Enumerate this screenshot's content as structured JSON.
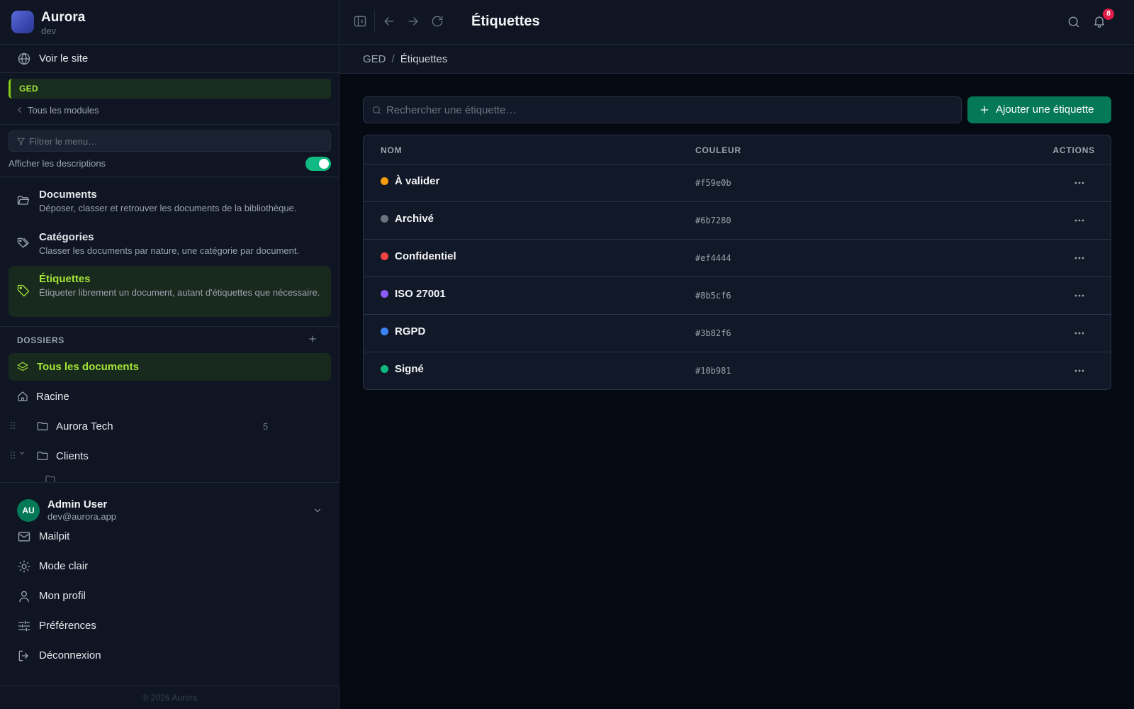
{
  "brand": {
    "name": "Aurora",
    "env": "dev"
  },
  "sidebar": {
    "view_site": "Voir le site",
    "module_badge": "GED",
    "all_modules": "Tous les modules",
    "filter_placeholder": "Filtrer le menu…",
    "show_descriptions": "Afficher les descriptions",
    "show_descriptions_on": true,
    "nav": [
      {
        "title": "Documents",
        "desc": "Déposer, classer et retrouver les documents de la bibliothèque.",
        "icon": "folder-open-icon",
        "active": false
      },
      {
        "title": "Catégories",
        "desc": "Classer les documents par nature, une catégorie par document.",
        "icon": "tags-icon",
        "active": false
      },
      {
        "title": "Étiquettes",
        "desc": "Étiqueter librement un document, autant d'étiquettes que nécessaire.",
        "icon": "tag-icon",
        "active": true
      }
    ],
    "dossiers_label": "DOSSIERS",
    "folders": {
      "all": "Tous les documents",
      "root": "Racine",
      "items": [
        {
          "name": "Aurora Tech",
          "count": "5"
        },
        {
          "name": "Clients",
          "count": ""
        }
      ]
    }
  },
  "user": {
    "initials": "AU",
    "name": "Admin User",
    "email": "dev@aurora.app",
    "menu": [
      {
        "label": "Mailpit",
        "icon": "mail-icon"
      },
      {
        "label": "Mode clair",
        "icon": "sun-icon"
      },
      {
        "label": "Mon profil",
        "icon": "user-icon"
      },
      {
        "label": "Préférences",
        "icon": "sliders-icon"
      },
      {
        "label": "Déconnexion",
        "icon": "logout-icon"
      }
    ]
  },
  "footer": "© 2026 Aurora",
  "topbar": {
    "title": "Étiquettes",
    "notifications": "8"
  },
  "breadcrumb": {
    "parent": "GED",
    "separator": "/",
    "current": "Étiquettes"
  },
  "main": {
    "search_placeholder": "Rechercher une étiquette…",
    "add_button": "Ajouter une étiquette",
    "table": {
      "headers": {
        "name": "NOM",
        "color": "COULEUR",
        "actions": "ACTIONS"
      },
      "rows": [
        {
          "name": "À valider",
          "hex": "#f59e0b",
          "color": "#f59e0b"
        },
        {
          "name": "Archivé",
          "hex": "#6b7280",
          "color": "#6b7280"
        },
        {
          "name": "Confidentiel",
          "hex": "#ef4444",
          "color": "#ef4444"
        },
        {
          "name": "ISO 27001",
          "hex": "#8b5cf6",
          "color": "#8b5cf6"
        },
        {
          "name": "RGPD",
          "hex": "#3b82f6",
          "color": "#3b82f6"
        },
        {
          "name": "Signé",
          "hex": "#10b981",
          "color": "#10b981"
        }
      ]
    }
  },
  "colors": {
    "accent": "#a3e635",
    "primary_button": "#047857",
    "toggle_on": "#10b981",
    "notification_badge": "#e11d48"
  }
}
